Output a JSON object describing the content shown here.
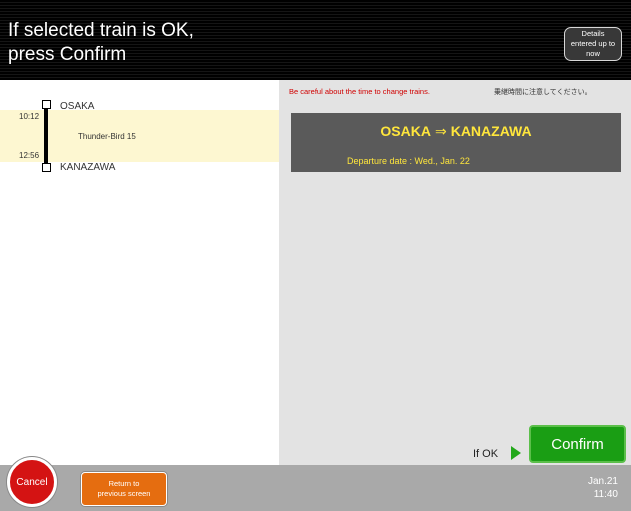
{
  "header": {
    "title": "If selected train is OK,\npress Confirm",
    "details_button": "Details entered up to now"
  },
  "itinerary": {
    "departure_station": "OSAKA",
    "arrival_station": "KANAZAWA",
    "departure_time": "10:12",
    "arrival_time": "12:56",
    "train_name": "Thunder-Bird 15"
  },
  "notice": {
    "warning_en": "Be careful about the time to change trains.",
    "warning_jp": "乗継時間に注意してください。"
  },
  "summary": {
    "from": "OSAKA",
    "arrow": "⇒",
    "to": "KANAZAWA",
    "departure_date": "Departure date : Wed., Jan. 22"
  },
  "actions": {
    "if_ok_label": "If OK",
    "confirm_label": "Confirm",
    "cancel_label": "Cancel",
    "return_label": "Return to\nprevious screen"
  },
  "status": {
    "date": "Jan.21",
    "time": "11:40"
  },
  "colors": {
    "header_bg": "#000000",
    "confirm_green": "#1a9e14",
    "cancel_red": "#d41313",
    "return_orange": "#e56d10",
    "route_text_yellow": "#ffe63c",
    "warning_red": "#d00000",
    "segment_highlight": "#fdf7d1"
  }
}
